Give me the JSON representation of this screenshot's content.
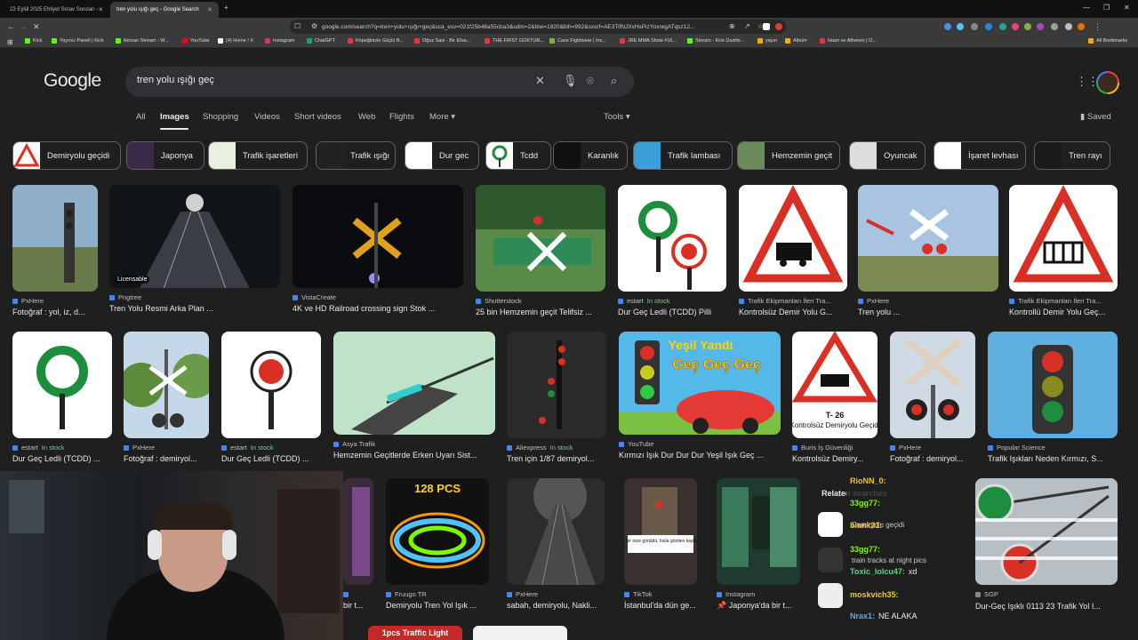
{
  "browser": {
    "tabs": [
      {
        "label": "23 Eylül 2025 Ehliyet Sınav Soruları -",
        "active": false
      },
      {
        "label": "tren yolu ışığı geç - Google Search",
        "active": true
      }
    ],
    "new_tab": "+",
    "url": "google.com/search?q=tren+yolu+ışığı+geç&sca_esv=021f25b48a55cba3&udm=2&biw=1920&bih=992&sxsrf=AE3TifNJXvHxPizYoxregATqsz12...",
    "bookmarks": [
      "Kick",
      "Yayıncı Paneli | Kick",
      "ikinsan Stream - W...",
      "YouTube",
      "(4) Home / X",
      "Instagram",
      "ChatGPT",
      "Köpeğinizle Güçlü B...",
      "Oğuz Sasi - Bir Efsa...",
      "THE FIRST GOKTUR...",
      "Cave Fightwear | Ins...",
      "JRE MMA Show #16...",
      "Stream - Kick Dashb...",
      "yayın",
      "Albüm",
      "İslam ve Atheism | O..."
    ],
    "all_bookmarks": "All Bookmarks"
  },
  "google": {
    "logo": "Google",
    "query": "tren yolu ışığı geç",
    "nav": [
      "All",
      "Images",
      "Shopping",
      "Videos",
      "Short videos",
      "Web",
      "Flights",
      "More ▾"
    ],
    "tools": "Tools ▾",
    "saved": "Saved"
  },
  "chips": [
    "Demiryolu geçidi",
    "Japonya",
    "Trafik işaretleri",
    "Trafik ışığı",
    "Dur gec",
    "Tcdd",
    "Karanlık",
    "Trafik lambası",
    "Hemzemin geçit",
    "Oyuncak",
    "İşaret levhası",
    "Tren rayı"
  ],
  "row1": [
    {
      "source": "PxHere",
      "title": "Fotoğraf : yol, iz, d..."
    },
    {
      "source": "Pngtree",
      "title": "Tren Yolu Resmi Arka Plan ...",
      "badge": "Licensable"
    },
    {
      "source": "VistaCreate",
      "title": "4K ve HD Railroad crossing sign Stok ..."
    },
    {
      "source": "Shutterstock",
      "title": "25 bin Hemzemin geçit Telifsiz ..."
    },
    {
      "source": "estart",
      "stock": "In stock",
      "title": "Dur Geç Ledli (TCDD) Pilli"
    },
    {
      "source": "Trafik Ekipmanları İleri Tra...",
      "title": "Kontrolsüz Demir Yolu G..."
    },
    {
      "source": "PxHere",
      "title": "Tren yolu ..."
    },
    {
      "source": "Trafik Ekipmanları İleri Tra...",
      "title": "Kontrollü Demir Yolu Geç..."
    }
  ],
  "row2": [
    {
      "source": "estart",
      "stock": "In stock",
      "title": "Dur Geç Ledli (TCDD) ..."
    },
    {
      "source": "PxHere",
      "title": "Fotoğraf : demiryol..."
    },
    {
      "source": "estart",
      "stock": "In stock",
      "title": "Dur Geç Ledli (TCDD) ..."
    },
    {
      "source": "Asya Trafik",
      "title": "Hemzemin Geçitlerde Erken Uyarı Sist..."
    },
    {
      "source": "Aliexpress",
      "stock": "In stock",
      "title": "Tren için 1/87 demiryol..."
    },
    {
      "source": "YouTube",
      "title": "Kırmızı Işık Dur Dur Dur Yeşil Işık Geç ..."
    },
    {
      "source": "Buris İş Güvenliği",
      "title": "Kontrolsüz Demiry..."
    },
    {
      "source": "PxHere",
      "title": "Fotoğraf : demiryol..."
    },
    {
      "source": "Popular Science",
      "title": "Trafik Işıkları Neden Kırmızı, S..."
    }
  ],
  "row3": [
    {
      "source": "",
      "title": "bir t..."
    },
    {
      "source": "Fruugo TR",
      "title": "Demiryolu Tren Yol Işık ..."
    },
    {
      "source": "PxHere",
      "title": "sabah, demiryolu, Nakli..."
    },
    {
      "source": "TikTok",
      "title": "İstanbul'da dün ge..."
    },
    {
      "source": "Instagram",
      "title": "📌 Japonya'da bir t..."
    },
    {
      "source": "SGP",
      "title": "Dur-Geç Işıklı 0113 23 Trafik Yol I..."
    }
  ],
  "image_texts": {
    "t26": "T- 26",
    "kontrolsuz": "Kontrolsüz Demiryolu Geçidi",
    "yesil_yandi": "Yeşil Yandı",
    "gec": "Geç Geç Geç",
    "pcs": "128 PCS",
    "traffic_light": "1pcs Traffic Light",
    "kisa": "Kısa bir süre görüldü, hızla gözden kayboldu."
  },
  "related": {
    "title": "Related searches",
    "items": [
      "Demiryolu geçidi",
      "train tracks at night pics",
      ""
    ]
  },
  "chat": [
    {
      "user": "RioNN_0:",
      "color": "#f5c518",
      "msg": ""
    },
    {
      "user": "33gg77:",
      "color": "#7cfc00",
      "msg": ""
    },
    {
      "user": "blank31:",
      "color": "#f5c518",
      "msg": ""
    },
    {
      "user": "33gg77:",
      "color": "#7cfc00",
      "msg": ""
    },
    {
      "user": "Toxic_lolcu47:",
      "color": "#58d68d",
      "msg": "xd"
    },
    {
      "user": "moskvich35:",
      "color": "#f5c518",
      "msg": ""
    },
    {
      "user": "Nrax1:",
      "color": "#5dade2",
      "msg": "NE ALAKA"
    }
  ],
  "colors": {
    "bg": "#1f1f1f",
    "search_bg": "#303134",
    "stock": "#81c995",
    "red": "#d93025",
    "green": "#1e8e3e"
  }
}
